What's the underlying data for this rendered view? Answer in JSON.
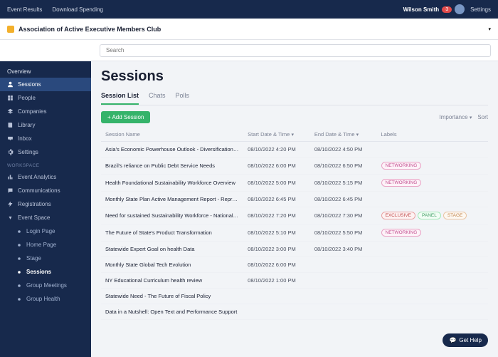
{
  "topbar": {
    "left": [
      "Event Results",
      "Download Spending"
    ],
    "user_name": "Wilson Smith",
    "badge": "3",
    "settings": "Settings"
  },
  "header": {
    "title": "Association of Active Executive Members Club",
    "search_placeholder": "Search"
  },
  "sidebar": {
    "group1_label": "Overview",
    "items": [
      {
        "label": "Sessions",
        "icon": "user"
      },
      {
        "label": "People",
        "icon": "grid"
      },
      {
        "label": "Companies",
        "icon": "layers"
      },
      {
        "label": "Library",
        "icon": "book"
      },
      {
        "label": "Inbox",
        "icon": "inbox"
      },
      {
        "label": "Settings",
        "icon": "gear"
      }
    ],
    "group2_label": "Workspace",
    "items2": [
      {
        "label": "Event Analytics",
        "icon": "chart"
      },
      {
        "label": "Communications",
        "icon": "chat"
      },
      {
        "label": "Registrations",
        "icon": "lightning"
      }
    ],
    "event_space_label": "Event Space",
    "subs": [
      {
        "label": "Login Page"
      },
      {
        "label": "Home Page"
      },
      {
        "label": "Stage"
      },
      {
        "label": "Sessions"
      },
      {
        "label": "Group Meetings"
      },
      {
        "label": "Group Health"
      }
    ]
  },
  "page": {
    "title": "Sessions",
    "tabs": [
      "Session List",
      "Chats",
      "Polls"
    ],
    "add_button": "+ Add Session",
    "filter_label": "Importance",
    "sort_label": "Sort",
    "columns": [
      "Session Name",
      "Start Date & Time",
      "End Date & Time",
      "Labels"
    ],
    "rows": [
      {
        "name": "Asia's Economic Powerhouse Outlook - Diversification Model",
        "start": "08/10/2022 4:20 PM",
        "end": "08/10/2022 4:50 PM",
        "tags": []
      },
      {
        "name": "Brazil's reliance on Public Debt Service Needs",
        "start": "08/10/2022 6:00 PM",
        "end": "08/10/2022 6:50 PM",
        "tags": [
          "NETWORKING"
        ]
      },
      {
        "name": "Health Foundational Sustainability Workforce Overview",
        "start": "08/10/2022 5:00 PM",
        "end": "08/10/2022 5:15 PM",
        "tags": [
          "NETWORKING"
        ]
      },
      {
        "name": "Monthly State Plan Active Management Report - Representation",
        "start": "08/10/2022 6:45 PM",
        "end": "08/10/2022 6:45 PM",
        "tags": []
      },
      {
        "name": "Need for sustained Sustainability Workforce - National Level",
        "start": "08/10/2022 7:20 PM",
        "end": "08/10/2022 7:30 PM",
        "tags": [
          "EXCLUSIVE",
          "PANEL",
          "STAGE"
        ]
      },
      {
        "name": "The Future of State's Product Transformation",
        "start": "08/10/2022 5:10 PM",
        "end": "08/10/2022 5:50 PM",
        "tags": [
          "NETWORKING"
        ]
      },
      {
        "name": "Statewide Expert Goal on health Data",
        "start": "08/10/2022 3:00 PM",
        "end": "08/10/2022 3:40 PM",
        "tags": []
      },
      {
        "name": "Monthly State Global Tech Evolution",
        "start": "08/10/2022 6:00 PM",
        "end": "",
        "tags": []
      },
      {
        "name": "NY Educational Curriculum health review",
        "start": "08/10/2022 1:00 PM",
        "end": "",
        "tags": []
      },
      {
        "name": "Statewide Need - The Future of Fiscal Policy",
        "start": "",
        "end": "",
        "tags": []
      },
      {
        "name": "Data in a Nutshell: Open Text and Performance Support",
        "start": "",
        "end": "",
        "tags": []
      }
    ],
    "help_label": "Get Help"
  },
  "tag_colors": {
    "NETWORKING": "pink",
    "EXCLUSIVE": "red",
    "PANEL": "green",
    "STAGE": "orange"
  }
}
